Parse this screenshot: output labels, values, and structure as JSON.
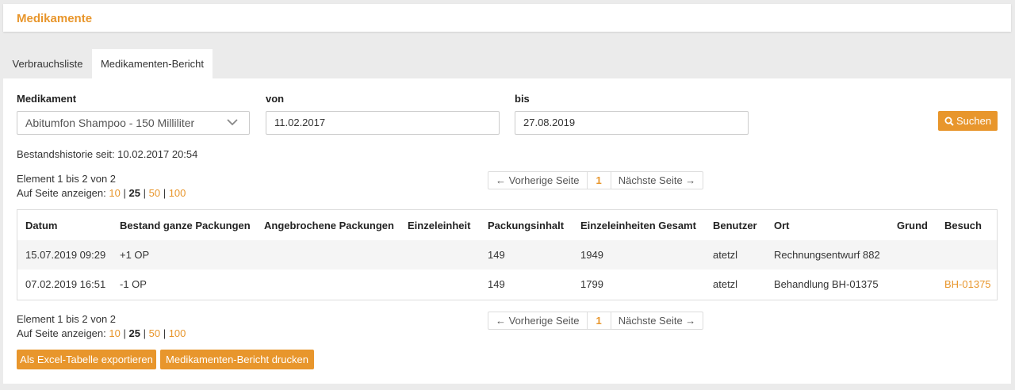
{
  "header": {
    "title": "Medikamente"
  },
  "tabs": [
    {
      "label": "Verbrauchsliste"
    },
    {
      "label": "Medikamenten-Bericht"
    }
  ],
  "form": {
    "medication_label": "Medikament",
    "medication_value": "Abitumfon Shampoo - 150 Milliliter",
    "from_label": "von",
    "from_value": "11.02.2017",
    "to_label": "bis",
    "to_value": "27.08.2019",
    "search_label": "Suchen"
  },
  "history_text": "Bestandshistorie seit: 10.02.2017 20:54",
  "paging": {
    "summary": "Element 1 bis 2 von 2",
    "per_page_label": "Auf Seite anzeigen:",
    "options": [
      "10",
      "25",
      "50",
      "100"
    ],
    "selected": "25",
    "separator": "|",
    "prev_label": "← Vorherige Seite",
    "current_page": "1",
    "next_label": "Nächste Seite →"
  },
  "table": {
    "columns": [
      "Datum",
      "Bestand ganze Packungen",
      "Angebrochene Packungen",
      "Einzeleinheit",
      "Packungsinhalt",
      "Einzeleinheiten Gesamt",
      "Benutzer",
      "Ort",
      "Grund",
      "Besuch"
    ],
    "rows": [
      {
        "datum": "15.07.2019 09:29",
        "bestand": "+1 OP",
        "angebrochen": "",
        "einzeleinheit": "",
        "packungsinhalt": "149",
        "gesamt": "1949",
        "benutzer": "atetzl",
        "ort": "Rechnungsentwurf 882",
        "grund": "",
        "besuch": ""
      },
      {
        "datum": "07.02.2019 16:51",
        "bestand": "-1 OP",
        "angebrochen": "",
        "einzeleinheit": "",
        "packungsinhalt": "149",
        "gesamt": "1799",
        "benutzer": "atetzl",
        "ort": "Behandlung BH-01375",
        "grund": "",
        "besuch": "BH-01375"
      }
    ]
  },
  "actions": {
    "export_label": "Als Excel-Tabelle exportieren",
    "print_label": "Medikamenten-Bericht drucken"
  },
  "colors": {
    "accent": "#e8962c",
    "background": "#ebebeb",
    "panel": "#ffffff",
    "row_stripe": "#f5f5f5"
  },
  "icons": {
    "search": "search-icon",
    "dropdown": "chevron-down-icon"
  }
}
